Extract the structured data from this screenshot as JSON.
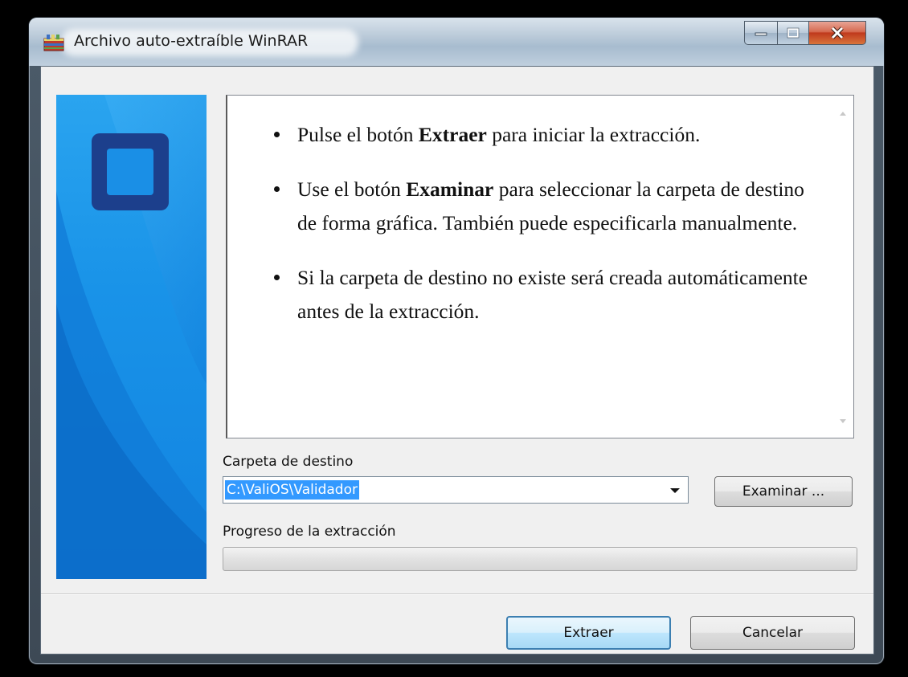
{
  "window": {
    "title": "Archivo auto-extraíble WinRAR",
    "icon": "winrar-archive-icon"
  },
  "caption_buttons": {
    "minimize": "minimize-icon",
    "maximize": "maximize-icon",
    "close": "close-icon"
  },
  "info": {
    "bullets": [
      {
        "pre": "Pulse el botón ",
        "bold": "Extraer",
        "post": " para iniciar la extracción."
      },
      {
        "pre": "Use el botón ",
        "bold": "Examinar",
        "post": " para seleccionar la carpeta de destino de forma gráfica. También puede especificarla manualmente."
      },
      {
        "pre": "Si la carpeta de destino no existe será creada automáticamente antes de la extracción.",
        "bold": "",
        "post": ""
      }
    ]
  },
  "destination": {
    "label": "Carpeta de destino",
    "value": "C:\\ValiOS\\Validador",
    "browse_label": "Examinar ..."
  },
  "progress": {
    "label": "Progreso de la extracción",
    "value": 0
  },
  "actions": {
    "extract_label": "Extraer",
    "cancel_label": "Cancelar"
  },
  "colors": {
    "accent": "#3399ff",
    "panel_blue": "#1a8fe6",
    "logo_navy": "#1c3f8c"
  }
}
